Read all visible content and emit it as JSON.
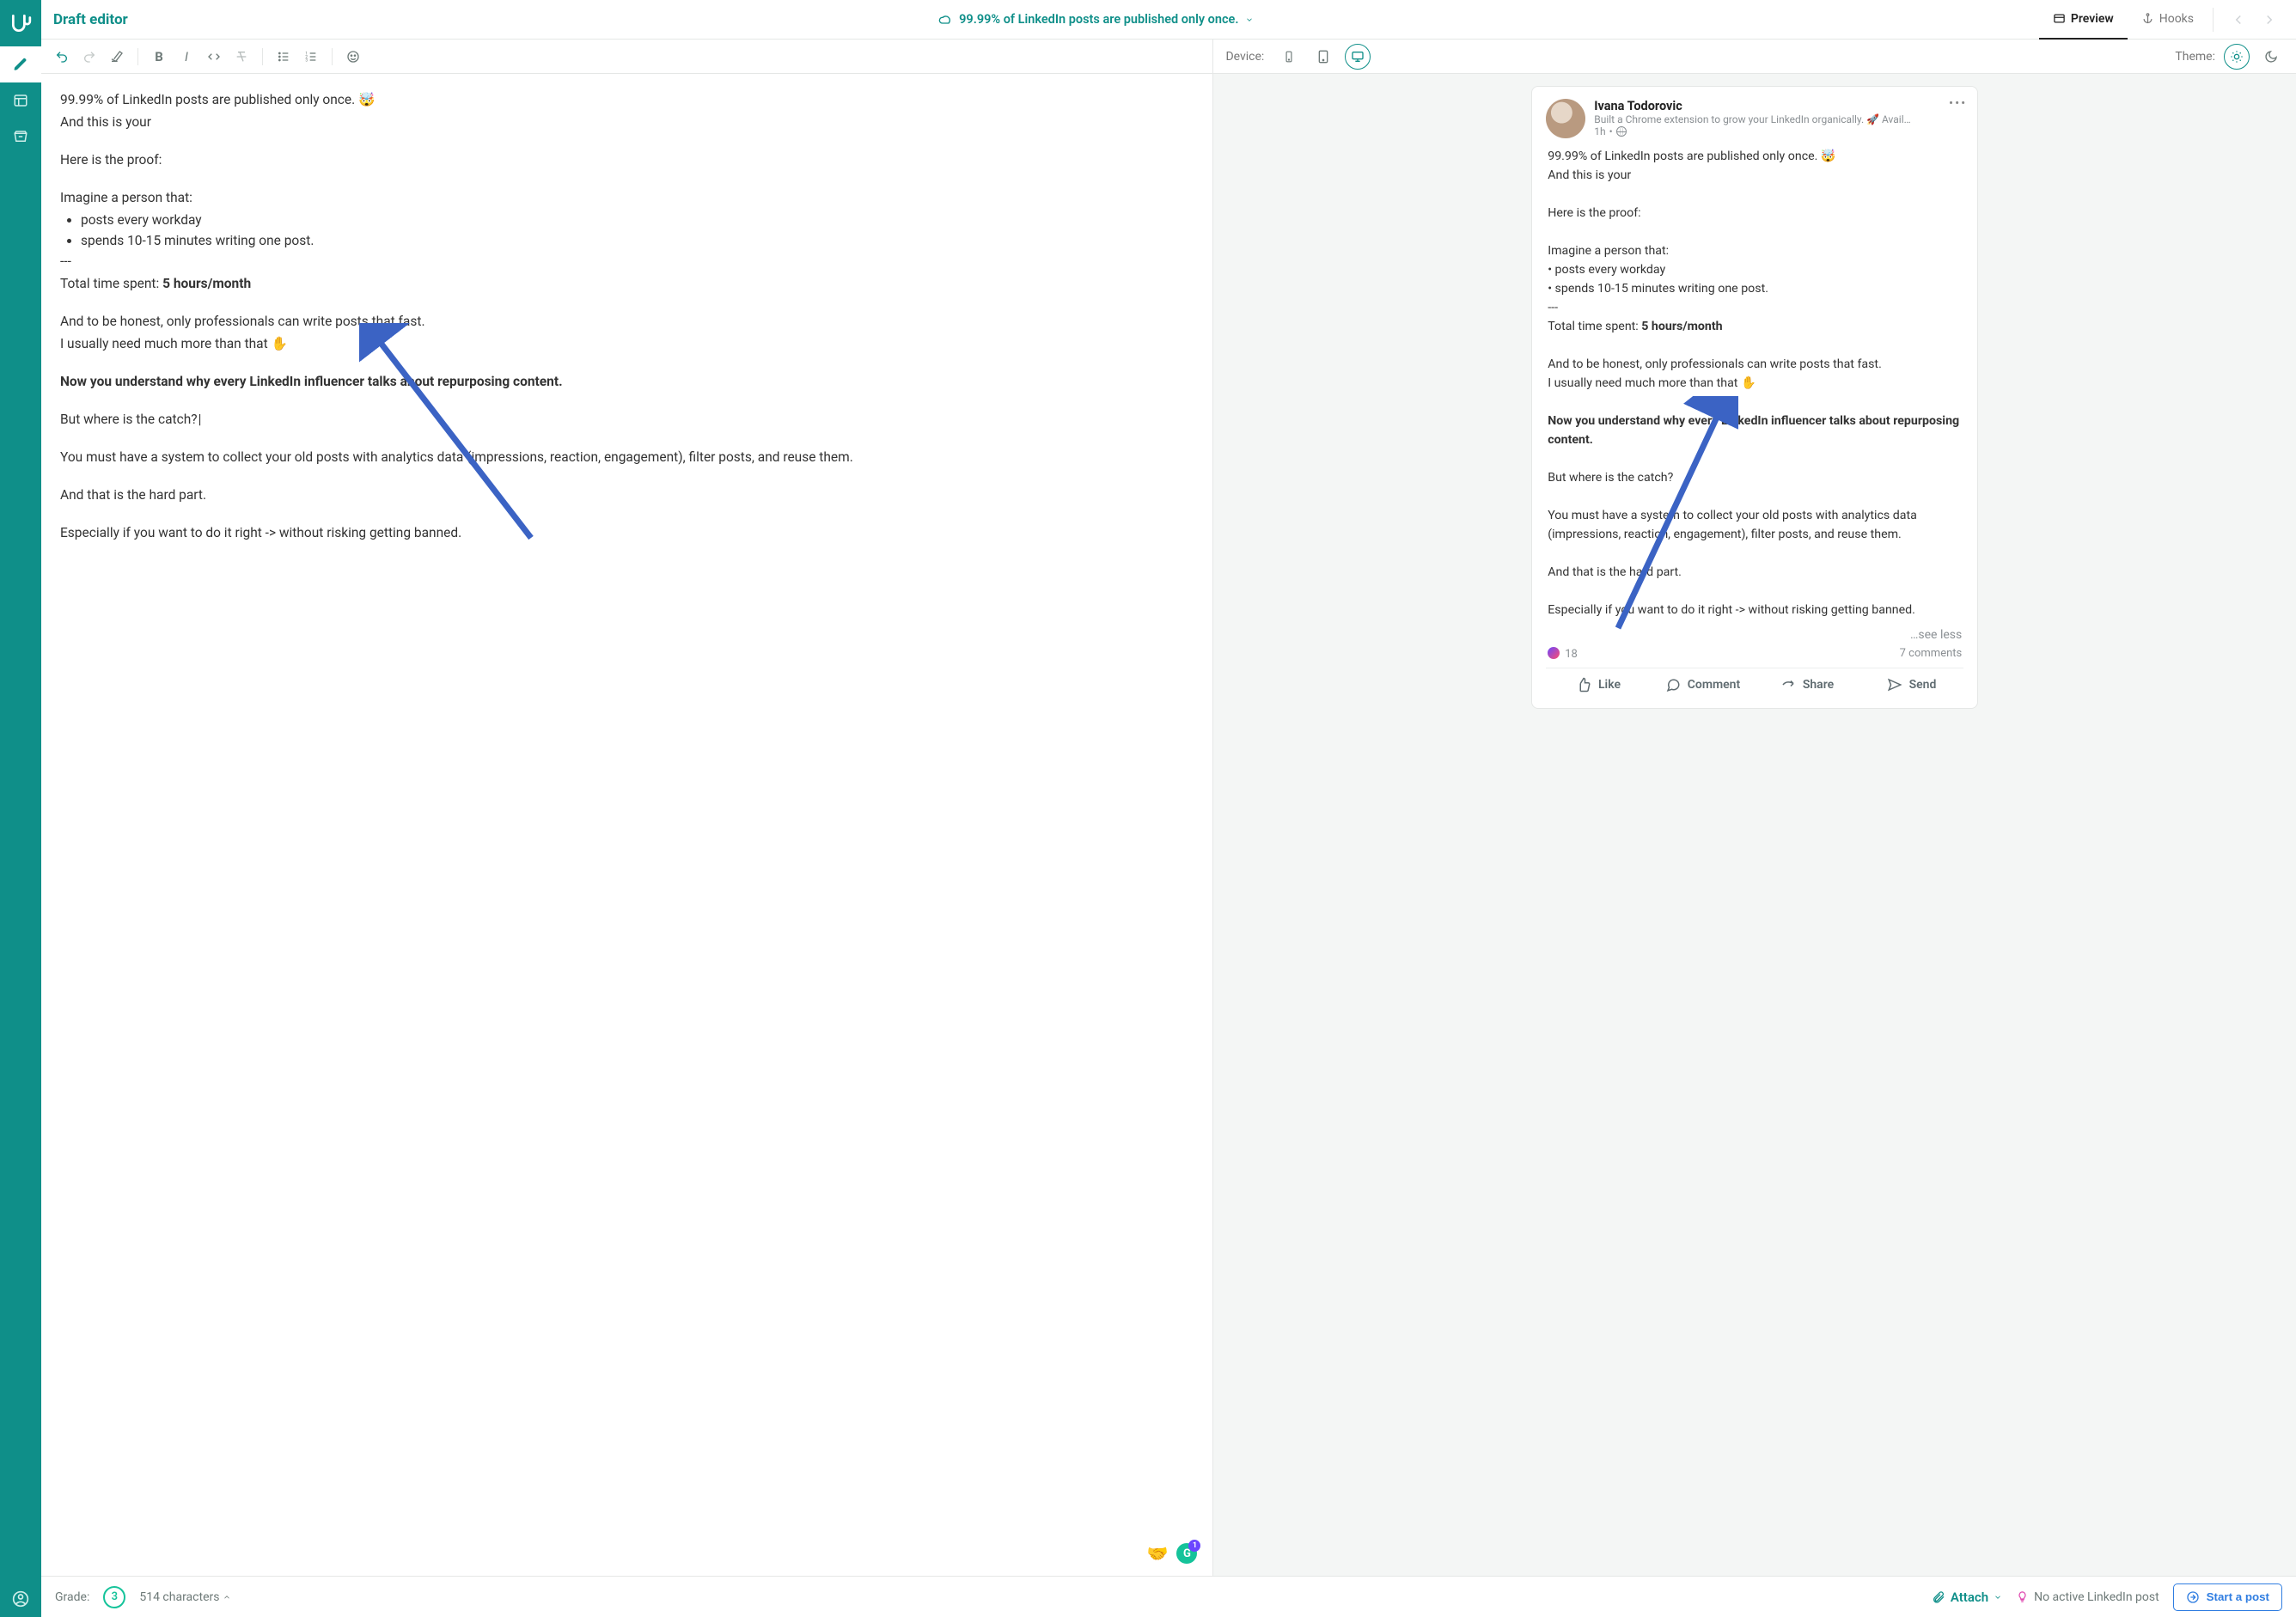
{
  "header": {
    "title": "Draft editor",
    "doc_title": "99.99% of LinkedIn posts are published only once.",
    "tabs": {
      "preview": "Preview",
      "hooks": "Hooks"
    }
  },
  "toolbar": {
    "device_label": "Device:",
    "theme_label": "Theme:"
  },
  "editor": {
    "l1": "99.99% of LinkedIn posts are published only once. 🤯",
    "l2": "And this is your",
    "l3": "Here is the proof:",
    "l4": "Imagine a person that:",
    "b1": "posts every workday",
    "b2": "spends 10-15 minutes writing one post.",
    "l5": "---",
    "l6a": "Total time spent: ",
    "l6b": "5 hours/month",
    "l7": "And to be honest, only professionals can write posts that fast.",
    "l8": "I usually need much more than that ✋",
    "l9": "Now you understand why every LinkedIn influencer talks about repurposing content.",
    "l10": "But where is the catch?",
    "l11": "You must have a system to collect your old posts with analytics data (impressions, reaction, engagement), filter posts, and reuse them.",
    "l12": "And that is the hard part.",
    "l13": "Especially if you want to do it right -> without risking getting banned.",
    "g_badge": "1"
  },
  "preview": {
    "author": {
      "name": "Ivana Todorovic",
      "subtitle": "Built a Chrome extension to grow your LinkedIn organically. 🚀 Available …",
      "time": "1h",
      "dot": "•"
    },
    "body": {
      "l1": "99.99% of LinkedIn posts are published only once. 🤯",
      "l2": "And this is your",
      "l3": "Here is the proof:",
      "l4": "Imagine a person that:",
      "b1": "• posts every workday",
      "b2": "• spends 10-15 minutes writing one post.",
      "l5": "---",
      "l6a": "Total time spent: ",
      "l6b": "5 hours/month",
      "l7": "And to be honest, only professionals can write posts that fast.",
      "l8": "I usually need much more than that ✋",
      "l9": "Now you understand why every LinkedIn influencer talks about repurposing content.",
      "l10": "But where is the catch?",
      "l11": "You must have a system to collect your old posts with analytics data (impressions, reaction, engagement), filter posts, and reuse them.",
      "l12": "And that is the hard part.",
      "l13": "Especially if you want to do it right -> without risking getting banned."
    },
    "see_less": "…see less",
    "reactions": "18",
    "comments": "7 comments",
    "actions": {
      "like": "Like",
      "comment": "Comment",
      "share": "Share",
      "send": "Send"
    }
  },
  "bottom": {
    "grade_label": "Grade:",
    "grade_value": "3",
    "characters": "514 characters",
    "attach": "Attach",
    "no_active": "No active LinkedIn post",
    "start_post": "Start a post"
  }
}
